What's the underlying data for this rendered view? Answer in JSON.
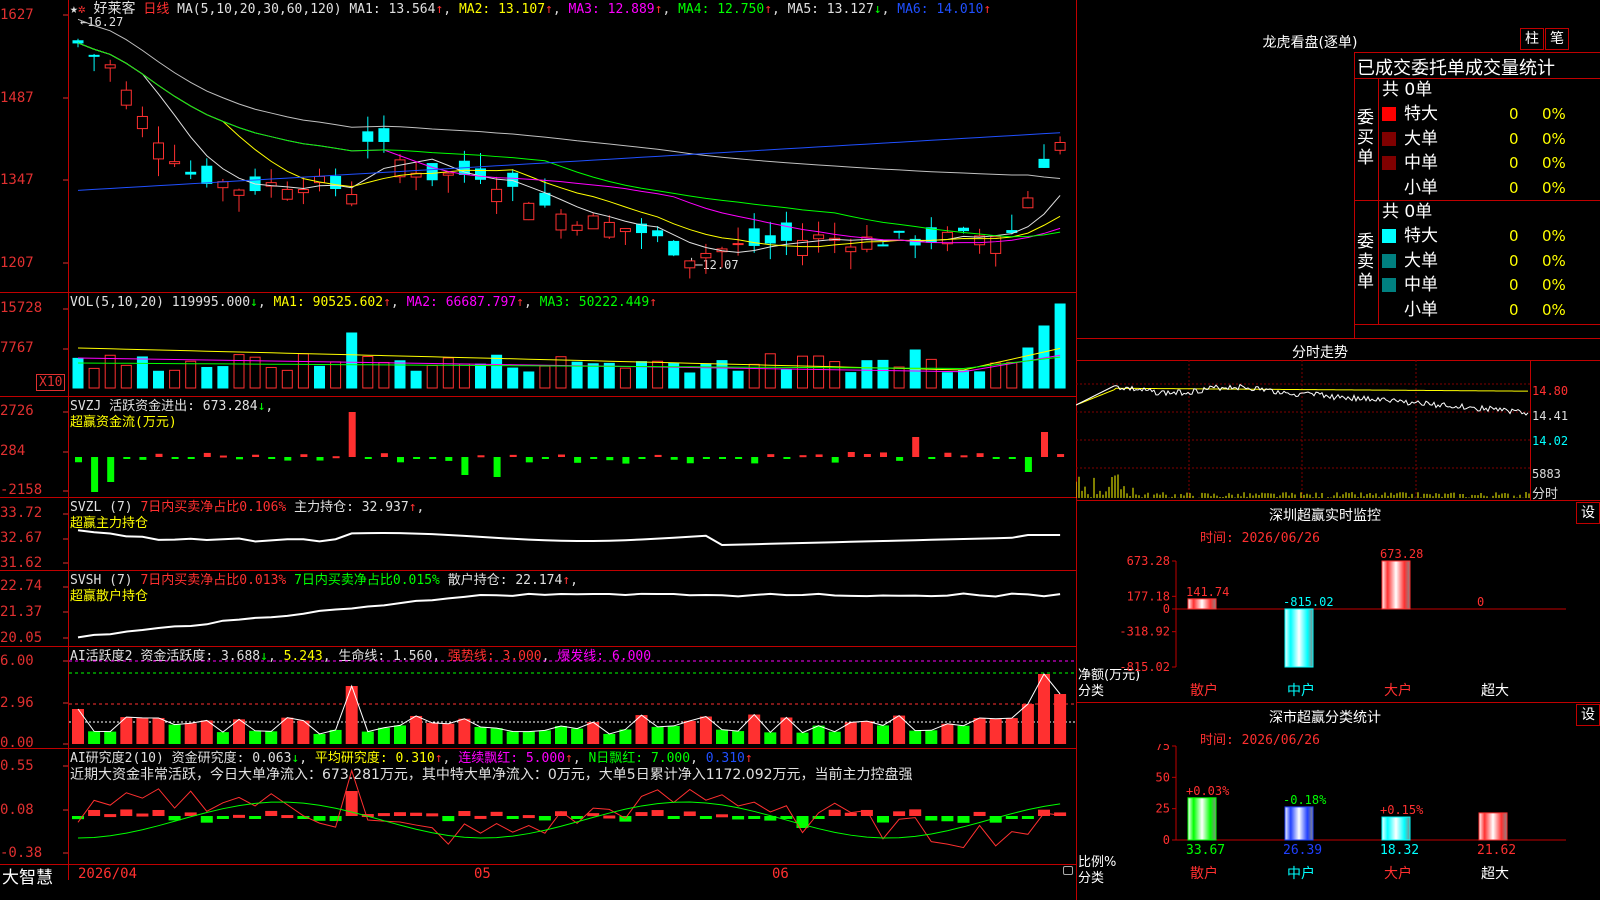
{
  "app": {
    "name": "大智慧",
    "stock": "好莱客",
    "period": "日线"
  },
  "kline": {
    "ma_label": "MA(5,10,20,30,60,120)",
    "ma": [
      {
        "label": "MA1: 13.564",
        "arrow": "↑",
        "color": "#e0e0e0"
      },
      {
        "label": "MA2: 13.107",
        "arrow": "↑",
        "color": "#ffff00"
      },
      {
        "label": "MA3: 12.889",
        "arrow": "↑",
        "color": "#ff00ff"
      },
      {
        "label": "MA4: 12.750",
        "arrow": "↑",
        "color": "#00ff00"
      },
      {
        "label": "MA5: 13.127",
        "arrow": "↓",
        "color": "#e0e0e0"
      },
      {
        "label": "MA6: 14.010",
        "arrow": "↑",
        "color": "#2050ff"
      }
    ],
    "high_note": "16.27",
    "low_note": "12.07",
    "y_ticks": [
      "1627",
      "1487",
      "1347",
      "1207"
    ]
  },
  "vol": {
    "label": "VOL(5,10,20)",
    "value": "119995.000",
    "arrow": "↓",
    "ma": [
      {
        "label": "MA1: 90525.602",
        "arrow": "↑",
        "color": "#ffff00"
      },
      {
        "label": "MA2: 66687.797",
        "arrow": "↑",
        "color": "#ff00ff"
      },
      {
        "label": "MA3: 50222.449",
        "arrow": "↑",
        "color": "#00ff00"
      }
    ],
    "y_ticks": [
      "15728",
      "7767"
    ],
    "unit": "X10"
  },
  "svzj": {
    "label": "SVZJ",
    "text": "活跃资金进出: 673.284",
    "arrow": "↓",
    "sub": "超赢资金流(万元)",
    "y_ticks": [
      "2726",
      "284",
      "-2158"
    ]
  },
  "svzl": {
    "label": "SVZL (7)",
    "t1": "7日内买卖净占比0.106%",
    "t2": "主力持仓: 32.937",
    "arrow": "↑",
    "sub": "超赢主力持仓",
    "y_ticks": [
      "33.72",
      "32.67",
      "31.62"
    ]
  },
  "svsh": {
    "label": "SVSH (7)",
    "t1": "7日内买卖净占比0.013%",
    "t2": "7日内买卖净占比0.015%",
    "t3": "散户持仓: 22.174",
    "arrow": "↑",
    "sub": "超赢散户持仓",
    "y_ticks": [
      "22.74",
      "21.37",
      "20.05"
    ]
  },
  "ai1": {
    "label": "AI活跃度2",
    "t1": "资金活跃度: 3.688",
    "a1": "↓",
    "t2": "5.243",
    "t3": "生命线: 1.560",
    "t4": "强势线: 3.000",
    "t5": "爆发线: 6.000",
    "y_ticks": [
      "6.00",
      "2.96",
      "0.00"
    ]
  },
  "ai2": {
    "label": "AI研究度2(10)",
    "t1": "资金研究度: 0.063",
    "a1": "↓",
    "t2": "平均研究度: 0.310",
    "a2": "↑",
    "t3": "连续飘红: 5.000",
    "a3": "↑",
    "t4": "N日飘红: 7.000",
    "t5": "0.310",
    "a5": "↑",
    "desc": "近期大资金非常活跃，今日大单净流入：673.281万元，其中特大单净流入：0万元，大单5日累计净入1172.092万元，当前主力控盘强",
    "y_ticks": [
      "0.55",
      "0.08",
      "-0.38"
    ]
  },
  "xaxis": {
    "labels": [
      "2026/04",
      "05",
      "06"
    ]
  },
  "lhb": {
    "title": "龙虎看盘(逐单)",
    "btn1": "柱",
    "btn2": "笔",
    "subtitle": "已成交委托单成交量统计",
    "buy": {
      "side": "委买单",
      "total": "共 0单",
      "rows": [
        {
          "name": "特大",
          "v": "0",
          "p": "0%",
          "color": "#ff0000"
        },
        {
          "name": "大单",
          "v": "0",
          "p": "0%",
          "color": "#800000"
        },
        {
          "name": "中单",
          "v": "0",
          "p": "0%",
          "color": "#800000"
        },
        {
          "name": "小单",
          "v": "0",
          "p": "0%",
          "color": "#000000"
        }
      ]
    },
    "sell": {
      "side": "委卖单",
      "total": "共 0单",
      "rows": [
        {
          "name": "特大",
          "v": "0",
          "p": "0%",
          "color": "#00ffff"
        },
        {
          "name": "大单",
          "v": "0",
          "p": "0%",
          "color": "#008080"
        },
        {
          "name": "中单",
          "v": "0",
          "p": "0%",
          "color": "#008080"
        },
        {
          "name": "小单",
          "v": "0",
          "p": "0%",
          "color": "#000000"
        }
      ]
    }
  },
  "fenshi": {
    "title": "分时走势",
    "p1": "14.80",
    "p2": "14.41",
    "p3": "14.02",
    "vol": "5883",
    "unit": "分时"
  },
  "monitor": {
    "title": "深圳超赢实时监控",
    "btn": "设",
    "time": "时间: 2026/06/26",
    "y_ticks": [
      "673.28",
      "177.18",
      "0",
      "-318.92",
      "-815.02"
    ],
    "ylabel1": "净额(万元)",
    "ylabel2": "分类",
    "chart_data": {
      "type": "bar",
      "categories": [
        "散户",
        "中户",
        "大户",
        "超大"
      ],
      "values": [
        141.74,
        -815.02,
        673.28,
        0
      ],
      "labels": [
        "141.74",
        "-815.02",
        "673.28",
        "0"
      ],
      "ylim": [
        -815.02,
        673.28
      ]
    }
  },
  "classify": {
    "title": "深市超赢分类统计",
    "btn": "设",
    "time": "时间: 2026/06/26",
    "y_ticks": [
      "75",
      "50",
      "25",
      "0"
    ],
    "ylabel1": "比例%",
    "ylabel2": "分类",
    "chart_data": {
      "type": "bar",
      "categories": [
        "散户",
        "中户",
        "大户",
        "超大"
      ],
      "values": [
        33.67,
        26.39,
        18.32,
        21.62
      ],
      "changes": [
        "+0.03%",
        "-0.18%",
        "+0.15%",
        ""
      ],
      "ylim": [
        0,
        75
      ]
    }
  }
}
